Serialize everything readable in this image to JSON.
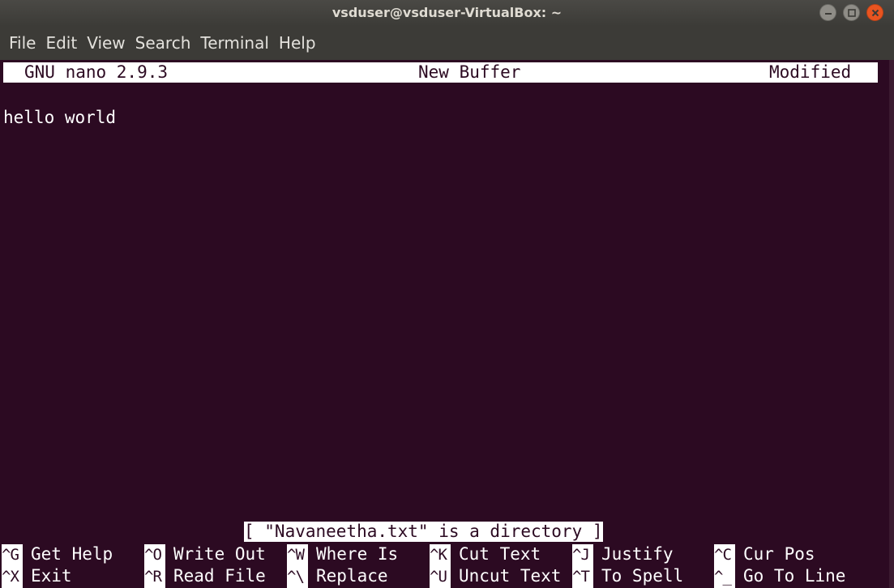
{
  "window": {
    "title": "vsduser@vsduser-VirtualBox: ~",
    "buttons": [
      "minimize-icon",
      "maximize-icon",
      "close-icon"
    ],
    "accent_close": "#e95420"
  },
  "menu": {
    "items": [
      "File",
      "Edit",
      "View",
      "Search",
      "Terminal",
      "Help"
    ]
  },
  "nano": {
    "header": {
      "version": "GNU nano 2.9.3",
      "buffer": "New Buffer",
      "state": "Modified"
    },
    "content": [
      "hello world"
    ],
    "status_message": "[ \"Navaneetha.txt\" is a directory ]",
    "shortcuts_row1": [
      {
        "key": "^G",
        "label": "Get Help"
      },
      {
        "key": "^O",
        "label": "Write Out"
      },
      {
        "key": "^W",
        "label": "Where Is"
      },
      {
        "key": "^K",
        "label": "Cut Text"
      },
      {
        "key": "^J",
        "label": "Justify"
      },
      {
        "key": "^C",
        "label": "Cur Pos"
      }
    ],
    "shortcuts_row2": [
      {
        "key": "^X",
        "label": "Exit"
      },
      {
        "key": "^R",
        "label": "Read File"
      },
      {
        "key": "^\\",
        "label": "Replace"
      },
      {
        "key": "^U",
        "label": "Uncut Text"
      },
      {
        "key": "^T",
        "label": "To Spell"
      },
      {
        "key": "^_",
        "label": "Go To Line"
      }
    ]
  },
  "colors": {
    "terminal_bg": "#2c0a22",
    "titlebar_bg": "#3c3b37",
    "text": "#ffffff"
  }
}
